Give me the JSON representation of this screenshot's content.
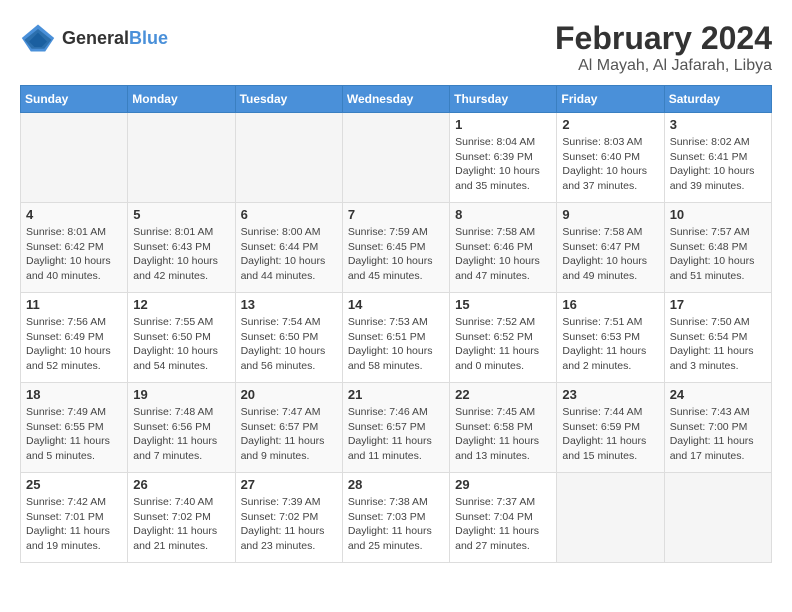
{
  "logo": {
    "general": "General",
    "blue": "Blue"
  },
  "title": "February 2024",
  "subtitle": "Al Mayah, Al Jafarah, Libya",
  "days_of_week": [
    "Sunday",
    "Monday",
    "Tuesday",
    "Wednesday",
    "Thursday",
    "Friday",
    "Saturday"
  ],
  "weeks": [
    [
      {
        "day": "",
        "info": ""
      },
      {
        "day": "",
        "info": ""
      },
      {
        "day": "",
        "info": ""
      },
      {
        "day": "",
        "info": ""
      },
      {
        "day": "1",
        "info": "Sunrise: 8:04 AM\nSunset: 6:39 PM\nDaylight: 10 hours\nand 35 minutes."
      },
      {
        "day": "2",
        "info": "Sunrise: 8:03 AM\nSunset: 6:40 PM\nDaylight: 10 hours\nand 37 minutes."
      },
      {
        "day": "3",
        "info": "Sunrise: 8:02 AM\nSunset: 6:41 PM\nDaylight: 10 hours\nand 39 minutes."
      }
    ],
    [
      {
        "day": "4",
        "info": "Sunrise: 8:01 AM\nSunset: 6:42 PM\nDaylight: 10 hours\nand 40 minutes."
      },
      {
        "day": "5",
        "info": "Sunrise: 8:01 AM\nSunset: 6:43 PM\nDaylight: 10 hours\nand 42 minutes."
      },
      {
        "day": "6",
        "info": "Sunrise: 8:00 AM\nSunset: 6:44 PM\nDaylight: 10 hours\nand 44 minutes."
      },
      {
        "day": "7",
        "info": "Sunrise: 7:59 AM\nSunset: 6:45 PM\nDaylight: 10 hours\nand 45 minutes."
      },
      {
        "day": "8",
        "info": "Sunrise: 7:58 AM\nSunset: 6:46 PM\nDaylight: 10 hours\nand 47 minutes."
      },
      {
        "day": "9",
        "info": "Sunrise: 7:58 AM\nSunset: 6:47 PM\nDaylight: 10 hours\nand 49 minutes."
      },
      {
        "day": "10",
        "info": "Sunrise: 7:57 AM\nSunset: 6:48 PM\nDaylight: 10 hours\nand 51 minutes."
      }
    ],
    [
      {
        "day": "11",
        "info": "Sunrise: 7:56 AM\nSunset: 6:49 PM\nDaylight: 10 hours\nand 52 minutes."
      },
      {
        "day": "12",
        "info": "Sunrise: 7:55 AM\nSunset: 6:50 PM\nDaylight: 10 hours\nand 54 minutes."
      },
      {
        "day": "13",
        "info": "Sunrise: 7:54 AM\nSunset: 6:50 PM\nDaylight: 10 hours\nand 56 minutes."
      },
      {
        "day": "14",
        "info": "Sunrise: 7:53 AM\nSunset: 6:51 PM\nDaylight: 10 hours\nand 58 minutes."
      },
      {
        "day": "15",
        "info": "Sunrise: 7:52 AM\nSunset: 6:52 PM\nDaylight: 11 hours\nand 0 minutes."
      },
      {
        "day": "16",
        "info": "Sunrise: 7:51 AM\nSunset: 6:53 PM\nDaylight: 11 hours\nand 2 minutes."
      },
      {
        "day": "17",
        "info": "Sunrise: 7:50 AM\nSunset: 6:54 PM\nDaylight: 11 hours\nand 3 minutes."
      }
    ],
    [
      {
        "day": "18",
        "info": "Sunrise: 7:49 AM\nSunset: 6:55 PM\nDaylight: 11 hours\nand 5 minutes."
      },
      {
        "day": "19",
        "info": "Sunrise: 7:48 AM\nSunset: 6:56 PM\nDaylight: 11 hours\nand 7 minutes."
      },
      {
        "day": "20",
        "info": "Sunrise: 7:47 AM\nSunset: 6:57 PM\nDaylight: 11 hours\nand 9 minutes."
      },
      {
        "day": "21",
        "info": "Sunrise: 7:46 AM\nSunset: 6:57 PM\nDaylight: 11 hours\nand 11 minutes."
      },
      {
        "day": "22",
        "info": "Sunrise: 7:45 AM\nSunset: 6:58 PM\nDaylight: 11 hours\nand 13 minutes."
      },
      {
        "day": "23",
        "info": "Sunrise: 7:44 AM\nSunset: 6:59 PM\nDaylight: 11 hours\nand 15 minutes."
      },
      {
        "day": "24",
        "info": "Sunrise: 7:43 AM\nSunset: 7:00 PM\nDaylight: 11 hours\nand 17 minutes."
      }
    ],
    [
      {
        "day": "25",
        "info": "Sunrise: 7:42 AM\nSunset: 7:01 PM\nDaylight: 11 hours\nand 19 minutes."
      },
      {
        "day": "26",
        "info": "Sunrise: 7:40 AM\nSunset: 7:02 PM\nDaylight: 11 hours\nand 21 minutes."
      },
      {
        "day": "27",
        "info": "Sunrise: 7:39 AM\nSunset: 7:02 PM\nDaylight: 11 hours\nand 23 minutes."
      },
      {
        "day": "28",
        "info": "Sunrise: 7:38 AM\nSunset: 7:03 PM\nDaylight: 11 hours\nand 25 minutes."
      },
      {
        "day": "29",
        "info": "Sunrise: 7:37 AM\nSunset: 7:04 PM\nDaylight: 11 hours\nand 27 minutes."
      },
      {
        "day": "",
        "info": ""
      },
      {
        "day": "",
        "info": ""
      }
    ]
  ]
}
